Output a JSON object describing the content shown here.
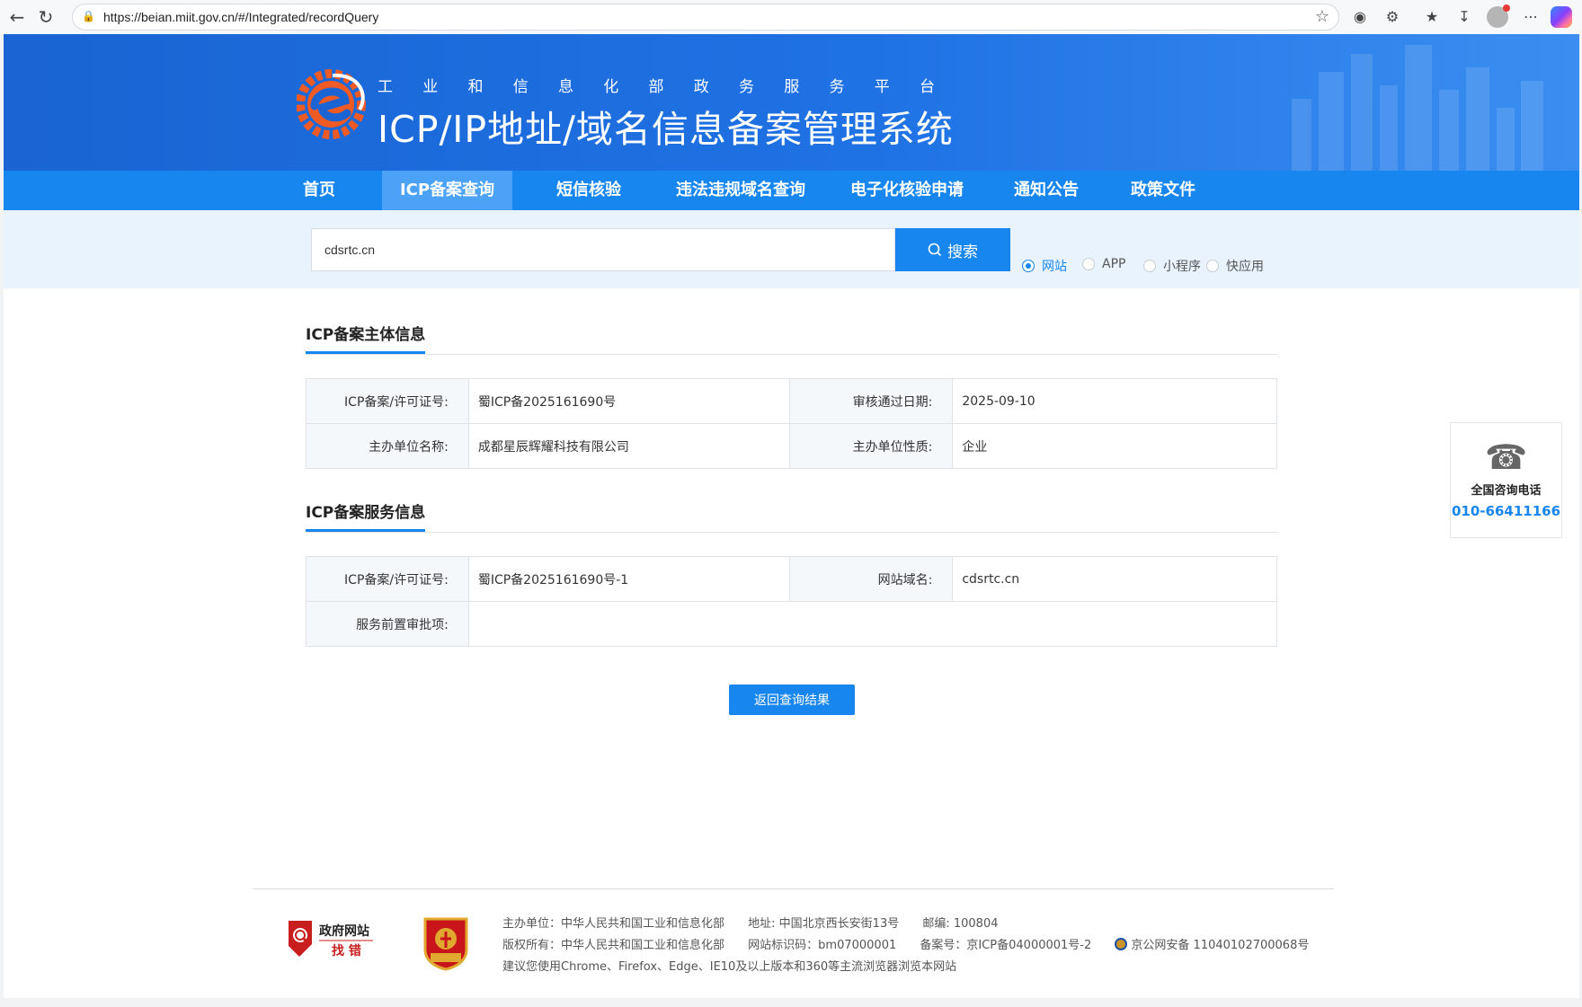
{
  "browser": {
    "url": "https://beian.miit.gov.cn/#/Integrated/recordQuery"
  },
  "header": {
    "subtitle_chars": [
      "工",
      "业",
      "和",
      "信",
      "息",
      "化",
      "部",
      "政",
      "务",
      "服",
      "务",
      "平",
      "台"
    ],
    "title": "ICP/IP地址/域名信息备案管理系统"
  },
  "menu": {
    "items": [
      {
        "label": "首页"
      },
      {
        "label": "ICP备案查询"
      },
      {
        "label": "短信核验"
      },
      {
        "label": "违法违规域名查询"
      },
      {
        "label": "电子化核验申请"
      },
      {
        "label": "通知公告"
      },
      {
        "label": "政策文件"
      }
    ],
    "active": "ICP备案查询"
  },
  "search": {
    "value": "cdsrtc.cn",
    "button_label": "搜索",
    "options": [
      "网站",
      "APP",
      "小程序",
      "快应用"
    ],
    "selected": "网站"
  },
  "subject": {
    "title": "ICP备案主体信息",
    "license_label": "ICP备案/许可证号:",
    "license_value": "蜀ICP备2025161690号",
    "date_label": "审核通过日期:",
    "date_value": "2025-09-10",
    "org_label": "主办单位名称:",
    "org_value": "成都星辰辉耀科技有限公司",
    "nature_label": "主办单位性质:",
    "nature_value": "企业"
  },
  "service": {
    "title": "ICP备案服务信息",
    "license_label": "ICP备案/许可证号:",
    "license_value": "蜀ICP备2025161690号-1",
    "domain_label": "网站域名:",
    "domain_value": "cdsrtc.cn",
    "approval_label": "服务前置审批项:",
    "approval_value": ""
  },
  "back_button": "返回查询结果",
  "contact": {
    "label": "全国咨询电话",
    "number": "010-66411166"
  },
  "footer": {
    "gov_logo_top": "政府网站",
    "gov_logo_bottom": "找 错",
    "party_logo_text": "党政机关",
    "host": "主办单位：中华人民共和国工业和信息化部",
    "address": "地址: 中国北京西长安街13号",
    "postcode": "邮编: 100804",
    "copyright": "版权所有：中华人民共和国工业和信息化部",
    "site_id": "网站标识码：bm07000001",
    "record": "备案号：京ICP备04000001号-2",
    "police": "京公网安备 11040102700068号",
    "browser_tip": "建议您使用Chrome、Firefox、Edge、IE10及以上版本和360等主流浏览器浏览本网站"
  },
  "colors": {
    "primary": "#1786ef",
    "banner": "#1f72e4"
  }
}
